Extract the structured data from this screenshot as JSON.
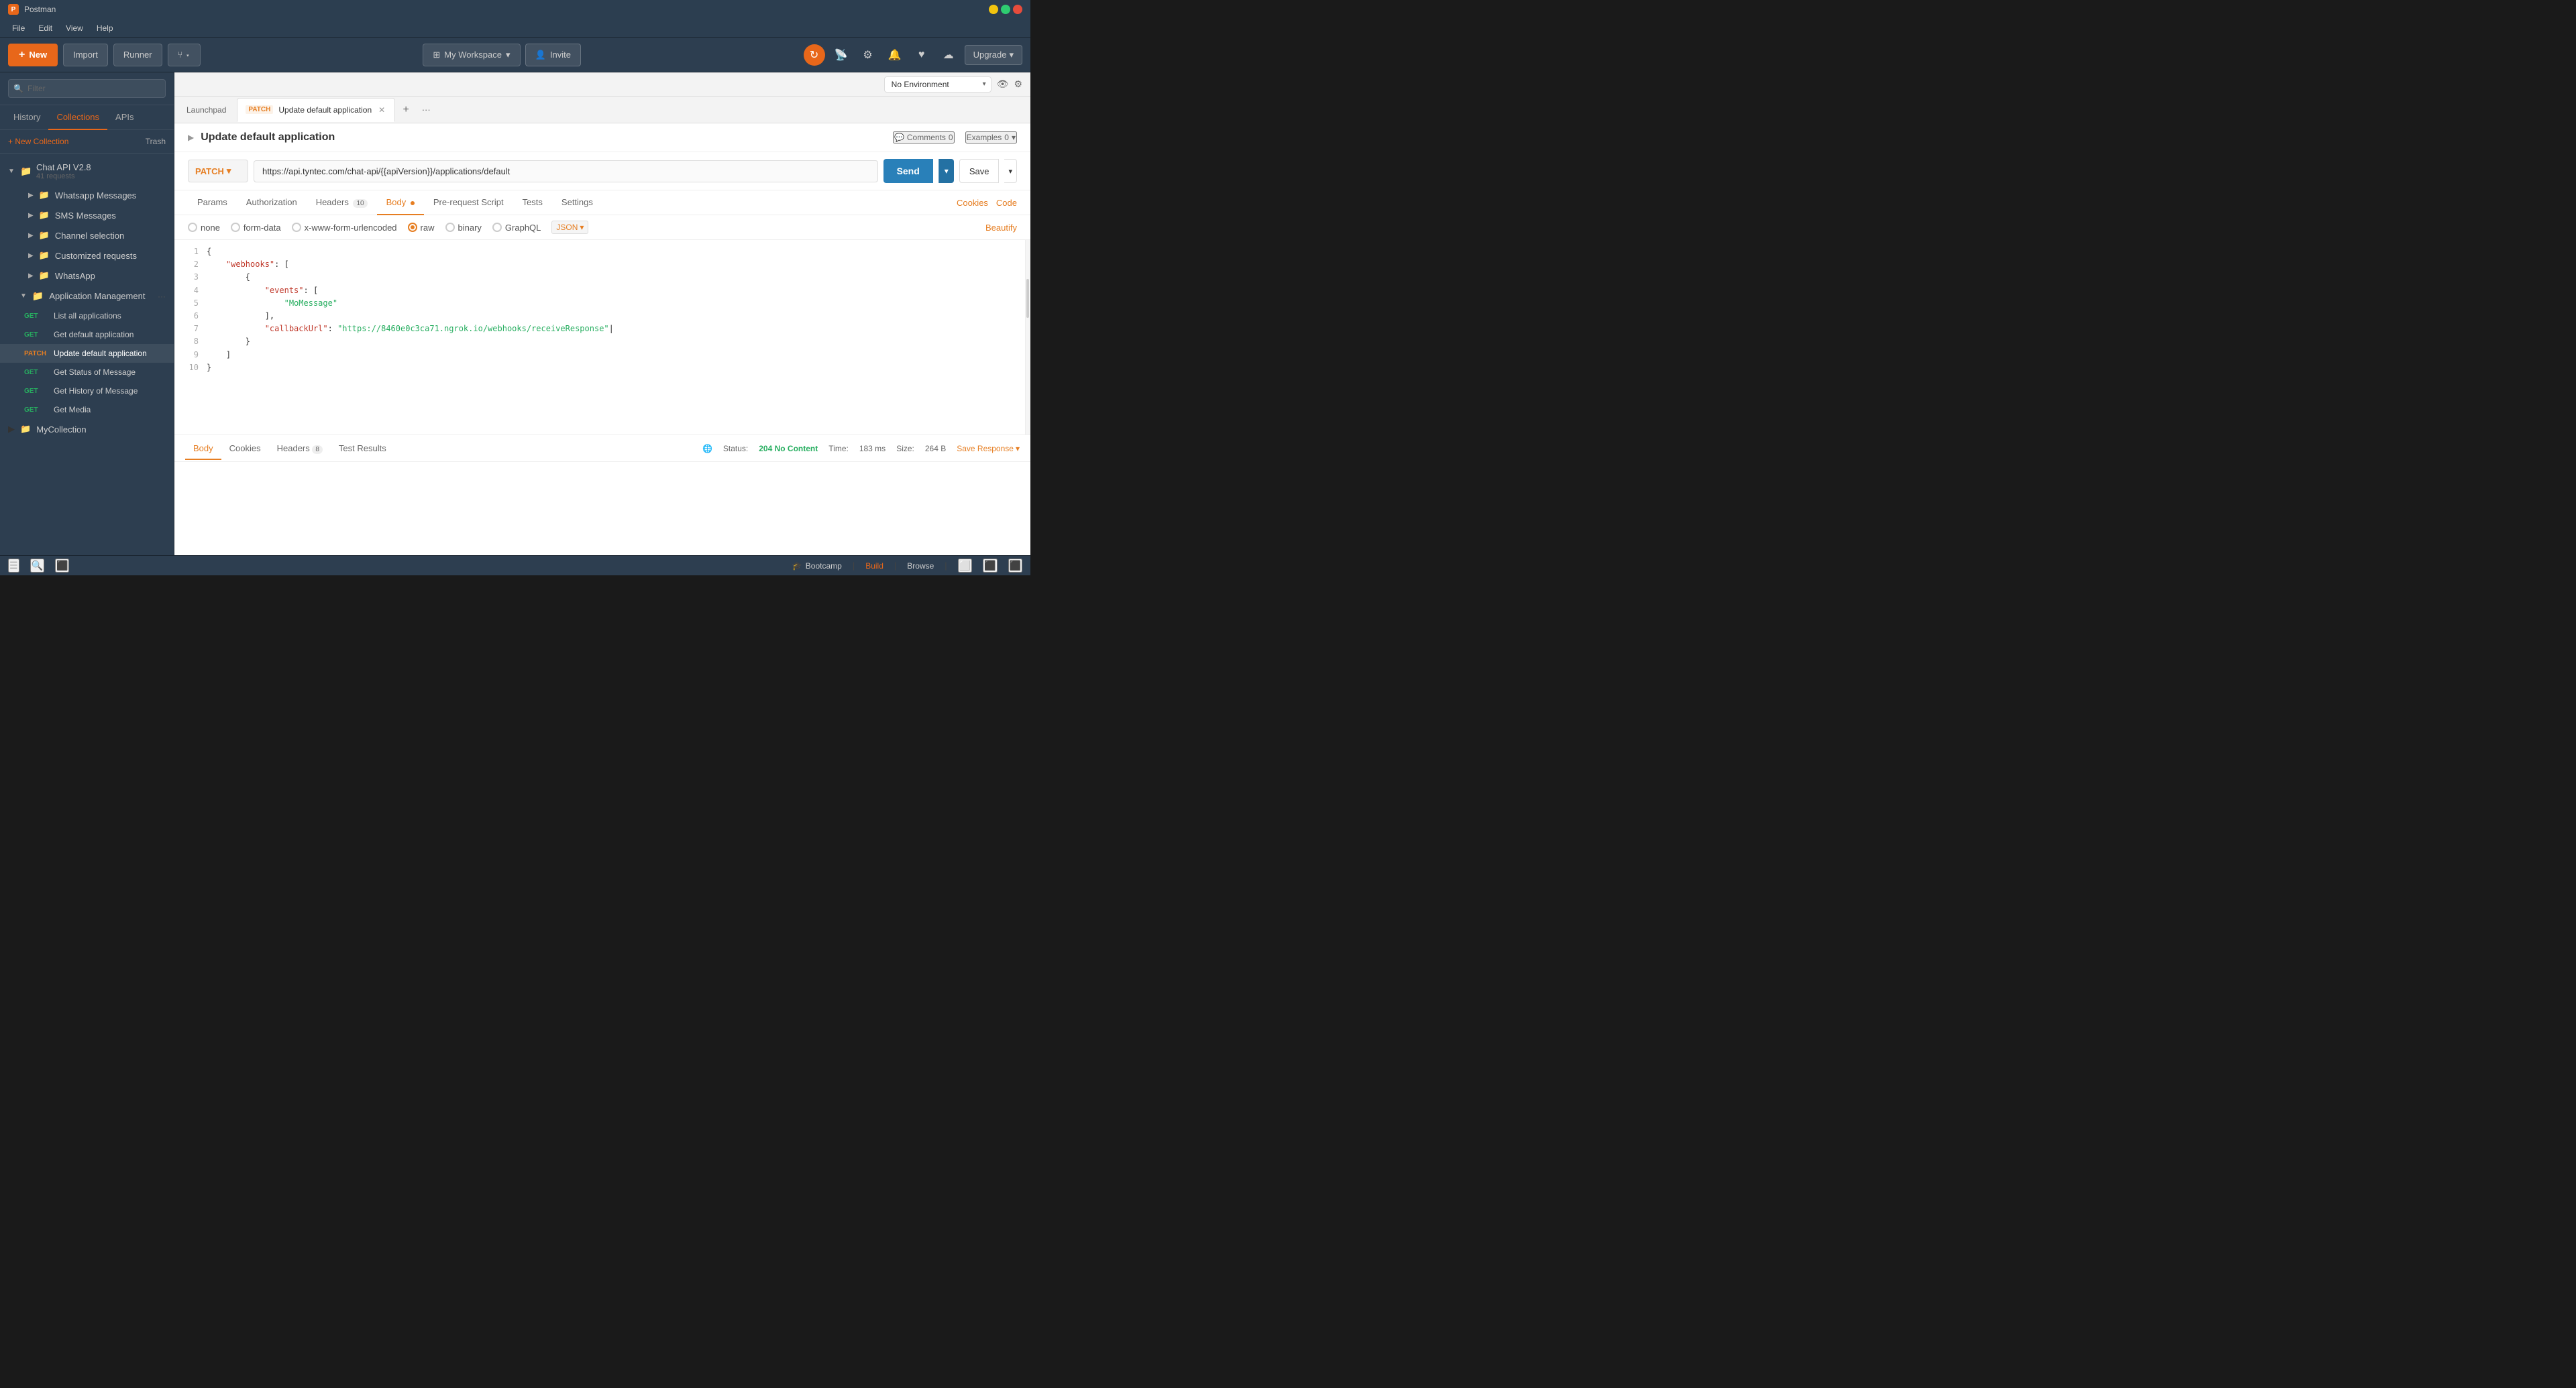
{
  "titlebar": {
    "app_name": "Postman",
    "min_label": "–",
    "max_label": "□",
    "close_label": "✕"
  },
  "menubar": {
    "items": [
      "File",
      "Edit",
      "View",
      "Help"
    ]
  },
  "toolbar": {
    "new_label": "New",
    "import_label": "Import",
    "runner_label": "Runner",
    "workspace_label": "My Workspace",
    "invite_label": "Invite",
    "upgrade_label": "Upgrade"
  },
  "env_bar": {
    "no_environment": "No Environment",
    "eye_icon": "👁",
    "gear_icon": "⚙"
  },
  "sidebar": {
    "search_placeholder": "Filter",
    "tabs": [
      "History",
      "Collections",
      "APIs"
    ],
    "active_tab": "Collections",
    "new_collection_label": "+ New Collection",
    "trash_label": "Trash",
    "collection": {
      "name": "Chat API V2.8",
      "count": "41 requests",
      "folders": [
        {
          "name": "Whatsapp Messages",
          "expanded": false
        },
        {
          "name": "SMS Messages",
          "expanded": false
        },
        {
          "name": "Channel selection",
          "expanded": false
        },
        {
          "name": "Customized requests",
          "expanded": false
        },
        {
          "name": "WhatsApp",
          "expanded": false
        },
        {
          "name": "Application Management",
          "expanded": true,
          "more": "···"
        }
      ],
      "requests": [
        {
          "method": "GET",
          "name": "List all applications"
        },
        {
          "method": "GET",
          "name": "Get default application"
        },
        {
          "method": "PATCH",
          "name": "Update default application",
          "active": true
        },
        {
          "method": "GET",
          "name": "Get Status of Message"
        },
        {
          "method": "GET",
          "name": "Get History of Message"
        },
        {
          "method": "GET",
          "name": "Get Media"
        }
      ]
    },
    "my_collection": "MyCollection"
  },
  "tabs": {
    "launchpad": "Launchpad",
    "active_tab": {
      "method": "PATCH",
      "name": "Update default application"
    }
  },
  "request": {
    "title": "Update default application",
    "comments_label": "Comments",
    "comments_count": "0",
    "examples_label": "Examples",
    "examples_count": "0",
    "method": "PATCH",
    "url": "https://api.tyntec.com/chat-api/{{apiVersion}}/applications/default",
    "url_base": "https://api.tyntec.com/chat-api/",
    "url_var": "{{apiVersion}}",
    "url_path": "/applications/default",
    "send_label": "Send",
    "save_label": "Save"
  },
  "request_tabs": {
    "items": [
      "Params",
      "Authorization",
      "Headers (10)",
      "Body",
      "Pre-request Script",
      "Tests",
      "Settings"
    ],
    "active": "Body",
    "cookies_label": "Cookies",
    "code_label": "Code"
  },
  "body_options": {
    "items": [
      "none",
      "form-data",
      "x-www-form-urlencoded",
      "raw",
      "binary",
      "GraphQL"
    ],
    "active": "raw",
    "format": "JSON",
    "beautify_label": "Beautify"
  },
  "code": {
    "lines": [
      {
        "num": "1",
        "content": "{"
      },
      {
        "num": "2",
        "content": "    \"webhooks\": ["
      },
      {
        "num": "3",
        "content": "        {"
      },
      {
        "num": "4",
        "content": "            \"events\": ["
      },
      {
        "num": "5",
        "content": "                \"MoMessage\""
      },
      {
        "num": "6",
        "content": "            ],"
      },
      {
        "num": "7",
        "content": "            \"callbackUrl\": \"https://8460e0c3ca71.ngrok.io/webhooks/receiveResponse\""
      },
      {
        "num": "8",
        "content": "        }"
      },
      {
        "num": "9",
        "content": "    ]"
      },
      {
        "num": "10",
        "content": "}"
      }
    ]
  },
  "response": {
    "tabs": [
      "Body",
      "Cookies",
      "Headers (8)",
      "Test Results"
    ],
    "active_tab": "Body",
    "status_label": "Status:",
    "status_value": "204 No Content",
    "time_label": "Time:",
    "time_value": "183 ms",
    "size_label": "Size:",
    "size_value": "264 B",
    "save_response_label": "Save Response"
  },
  "statusbar": {
    "bootcamp_label": "Bootcamp",
    "build_label": "Build",
    "browse_label": "Browse"
  }
}
